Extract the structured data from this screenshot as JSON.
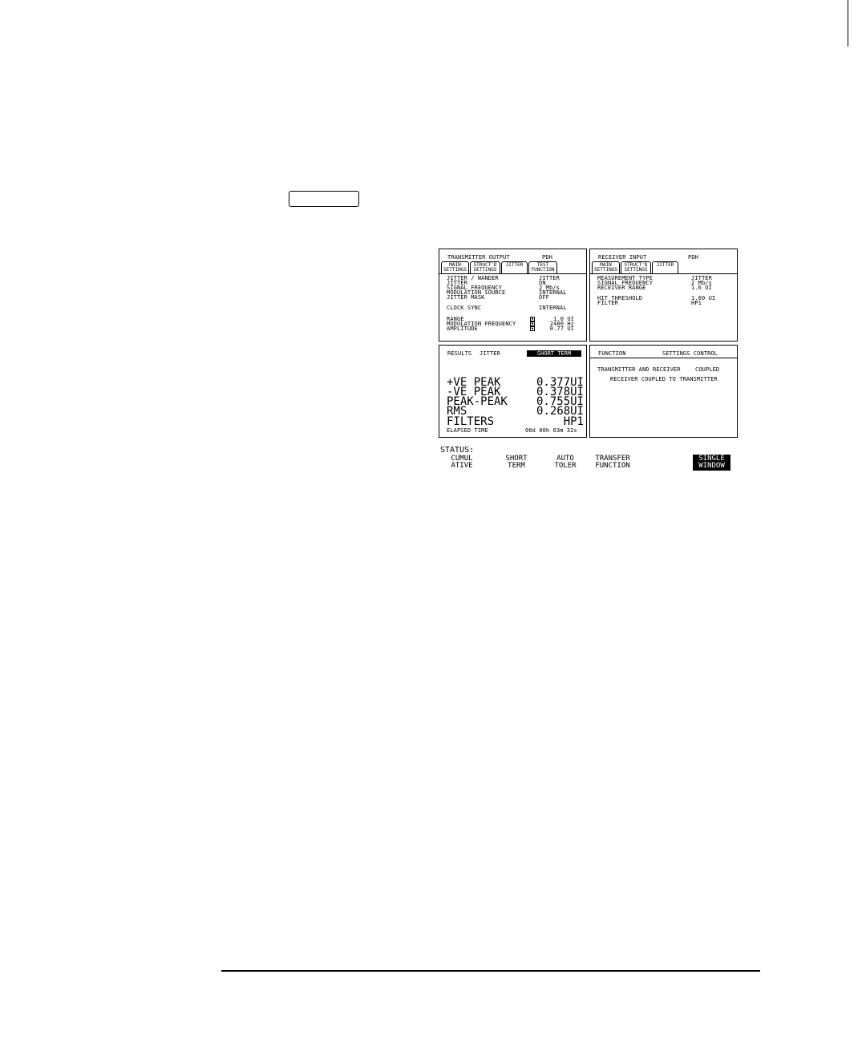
{
  "tx": {
    "title": "TRANSMITTER OUTPUT",
    "mode": "PDH",
    "tabs": [
      {
        "label1": "MAIN",
        "label2": "SETTINGS"
      },
      {
        "label1": "STRUCT'D",
        "label2": "SETTINGS"
      },
      {
        "label1": "JITTER",
        "label2": ""
      },
      {
        "label1": "TEST",
        "label2": "FUNCTION"
      }
    ],
    "rows": [
      {
        "label": "JITTER / WANDER",
        "value": "JITTER"
      },
      {
        "label": "JITTER",
        "value": "ON"
      },
      {
        "label": "SIGNAL FREQUENCY",
        "value": "2 Mb/s"
      },
      {
        "label": "MODULATION SOURCE",
        "value": "INTERNAL"
      },
      {
        "label": "JITTER MASK",
        "value": "OFF"
      }
    ],
    "clock_sync": {
      "label": "CLOCK SYNC",
      "value": "INTERNAL"
    },
    "range": {
      "label": "RANGE",
      "value": "1.0 UI"
    },
    "mod_freq": {
      "label": "MODULATION FREQUENCY",
      "value": "2400 Hz"
    },
    "amplitude": {
      "label": "AMPLITUDE",
      "value": "0.77 UI"
    }
  },
  "rx": {
    "title": "RECEIVER INPUT",
    "mode": "PDH",
    "tabs": [
      {
        "label1": "MAIN",
        "label2": "SETTINGS"
      },
      {
        "label1": "STRUCT'D",
        "label2": "SETTINGS"
      },
      {
        "label1": "JITTER",
        "label2": ""
      }
    ],
    "rows": [
      {
        "label": "MEASUREMENT TYPE",
        "value": "JITTER"
      },
      {
        "label": "SIGNAL FREQUENCY",
        "value": "2 Mb/s"
      },
      {
        "label": "RECEIVER RANGE",
        "value": "1.6  UI"
      }
    ],
    "hit_threshold": {
      "label": "HIT THRESHOLD",
      "value": "1.00 UI"
    },
    "filter": {
      "label": "FILTER",
      "value": "HP1"
    }
  },
  "results": {
    "title": "RESULTS",
    "type": "JITTER",
    "period": "SHORT TERM",
    "rows": [
      {
        "label": "+VE PEAK",
        "value": "0.377UI"
      },
      {
        "label": "-VE PEAK",
        "value": "0.378UI"
      },
      {
        "label": "PEAK-PEAK",
        "value": "0.755UI"
      },
      {
        "label": "RMS",
        "value": "0.268UI"
      },
      {
        "label": "FILTERS",
        "value": "HP1"
      }
    ],
    "elapsed": {
      "label": "ELAPSED TIME",
      "value": "00d 00h 03m 32s"
    }
  },
  "function": {
    "title": "FUNCTION",
    "name": "SETTINGS CONTROL",
    "row": {
      "label": "TRANSMITTER AND RECEIVER",
      "value": "COUPLED"
    },
    "message": "RECEIVER COUPLED TO TRANSMITTER"
  },
  "status": {
    "label": "STATUS:"
  },
  "softkeys": [
    {
      "label": "CUMUL\nATIVE"
    },
    {
      "label": "SHORT\nTERM"
    },
    {
      "label": "AUTO\nTOLER"
    },
    {
      "label": "TRANSFER\nFUNCTION"
    },
    {
      "label": "SINGLE\nWINDOW"
    }
  ]
}
